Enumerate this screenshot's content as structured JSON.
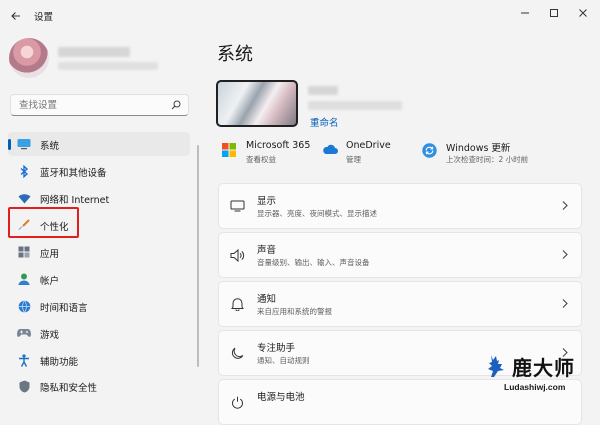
{
  "window": {
    "title": "设置"
  },
  "search": {
    "placeholder": "查找设置"
  },
  "sidebar": {
    "items": [
      {
        "label": "系统",
        "icon": "monitor-icon"
      },
      {
        "label": "蓝牙和其他设备",
        "icon": "bluetooth-icon"
      },
      {
        "label": "网络和 Internet",
        "icon": "wifi-icon"
      },
      {
        "label": "个性化",
        "icon": "brush-icon"
      },
      {
        "label": "应用",
        "icon": "apps-icon"
      },
      {
        "label": "帐户",
        "icon": "account-icon"
      },
      {
        "label": "时间和语言",
        "icon": "globe-clock-icon"
      },
      {
        "label": "游戏",
        "icon": "gamepad-icon"
      },
      {
        "label": "辅助功能",
        "icon": "accessibility-icon"
      },
      {
        "label": "隐私和安全性",
        "icon": "shield-icon"
      }
    ],
    "active_index": 0
  },
  "main": {
    "title": "系统",
    "device": {
      "rename_label": "重命名"
    },
    "status": [
      {
        "title": "Microsoft 365",
        "subtitle": "查看权益",
        "icon": "microsoft-logo-icon"
      },
      {
        "title": "OneDrive",
        "subtitle": "管理",
        "icon": "cloud-icon"
      },
      {
        "title": "Windows 更新",
        "subtitle": "上次检查时间：2 小时前",
        "icon": "update-icon"
      }
    ],
    "cards": [
      {
        "title": "显示",
        "subtitle": "显示器、亮度、夜间模式、显示描述",
        "icon": "display-icon"
      },
      {
        "title": "声音",
        "subtitle": "音量级别、输出、输入、声音设备",
        "icon": "speaker-icon"
      },
      {
        "title": "通知",
        "subtitle": "来自应用和系统的警报",
        "icon": "bell-icon"
      },
      {
        "title": "专注助手",
        "subtitle": "通知、自动规则",
        "icon": "moon-icon"
      },
      {
        "title": "电源与电池",
        "subtitle": "",
        "icon": "power-icon"
      }
    ]
  },
  "watermark": {
    "main": "鹿大师",
    "sub": "Ludashiwj.com"
  },
  "colors": {
    "accent": "#005fb8",
    "highlight_box": "#e02020",
    "background": "#f3f3f3",
    "card": "#fbfbfb"
  }
}
